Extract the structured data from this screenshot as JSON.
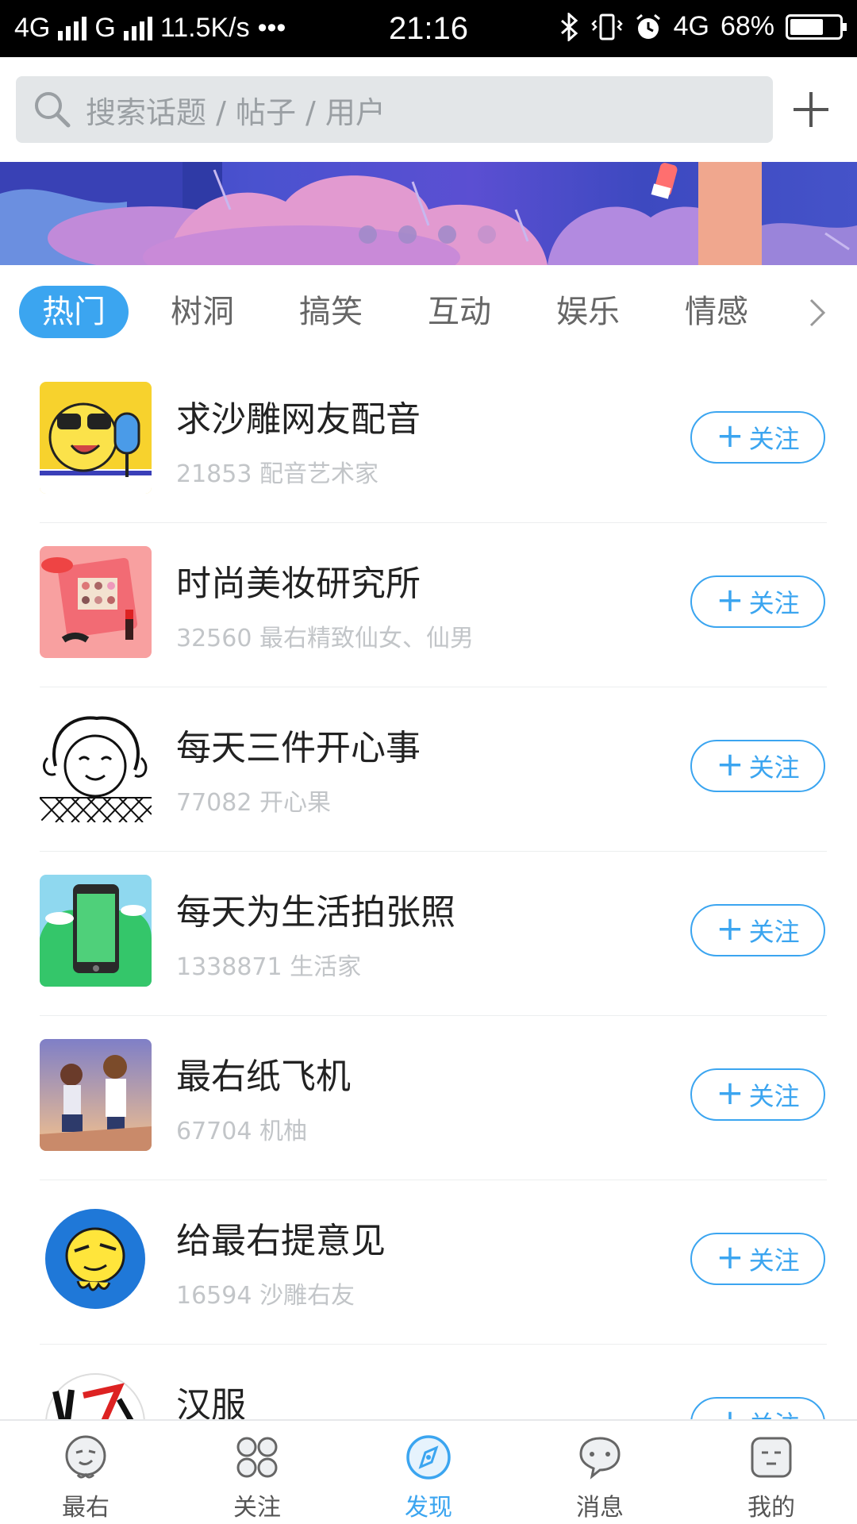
{
  "status_bar": {
    "network1": "4G",
    "network2": "G",
    "speed": "11.5K/s",
    "more": "•••",
    "time": "21:16",
    "network3": "4G",
    "battery": "68%",
    "battery_level": 0.68
  },
  "search": {
    "placeholder": "搜索话题 / 帖子 / 用户"
  },
  "banner": {
    "page_count": 4,
    "active_index": 0
  },
  "tabs": [
    {
      "label": "热门",
      "active": true
    },
    {
      "label": "树洞",
      "active": false
    },
    {
      "label": "搞笑",
      "active": false
    },
    {
      "label": "互动",
      "active": false
    },
    {
      "label": "娱乐",
      "active": false
    },
    {
      "label": "情感",
      "active": false
    }
  ],
  "follow_label": "关注",
  "topics": [
    {
      "title": "求沙雕网友配音",
      "subtitle": "21853 配音艺术家",
      "icon": "mic-mascot-icon"
    },
    {
      "title": "时尚美妆研究所",
      "subtitle": "32560 最右精致仙女、仙男",
      "icon": "makeup-icon"
    },
    {
      "title": "每天三件开心事",
      "subtitle": "77082 开心果",
      "icon": "happy-girl-icon"
    },
    {
      "title": "每天为生活拍张照",
      "subtitle": "1338871 生活家",
      "icon": "phone-photo-icon"
    },
    {
      "title": "最右纸飞机",
      "subtitle": "67704 机柚",
      "icon": "anime-couple-icon"
    },
    {
      "title": "给最右提意见",
      "subtitle": "16594 沙雕右友",
      "icon": "mascot-icon"
    },
    {
      "title": "汉服",
      "subtitle": "",
      "icon": "hanfu-icon"
    }
  ],
  "bottom_nav": [
    {
      "label": "最右",
      "icon": "home-mascot-icon",
      "active": false
    },
    {
      "label": "关注",
      "icon": "grid-icon",
      "active": false
    },
    {
      "label": "发现",
      "icon": "compass-icon",
      "active": true
    },
    {
      "label": "消息",
      "icon": "chat-icon",
      "active": false
    },
    {
      "label": "我的",
      "icon": "profile-icon",
      "active": false
    }
  ],
  "colors": {
    "accent": "#3ba5f0",
    "banner": "#4a52cf"
  }
}
